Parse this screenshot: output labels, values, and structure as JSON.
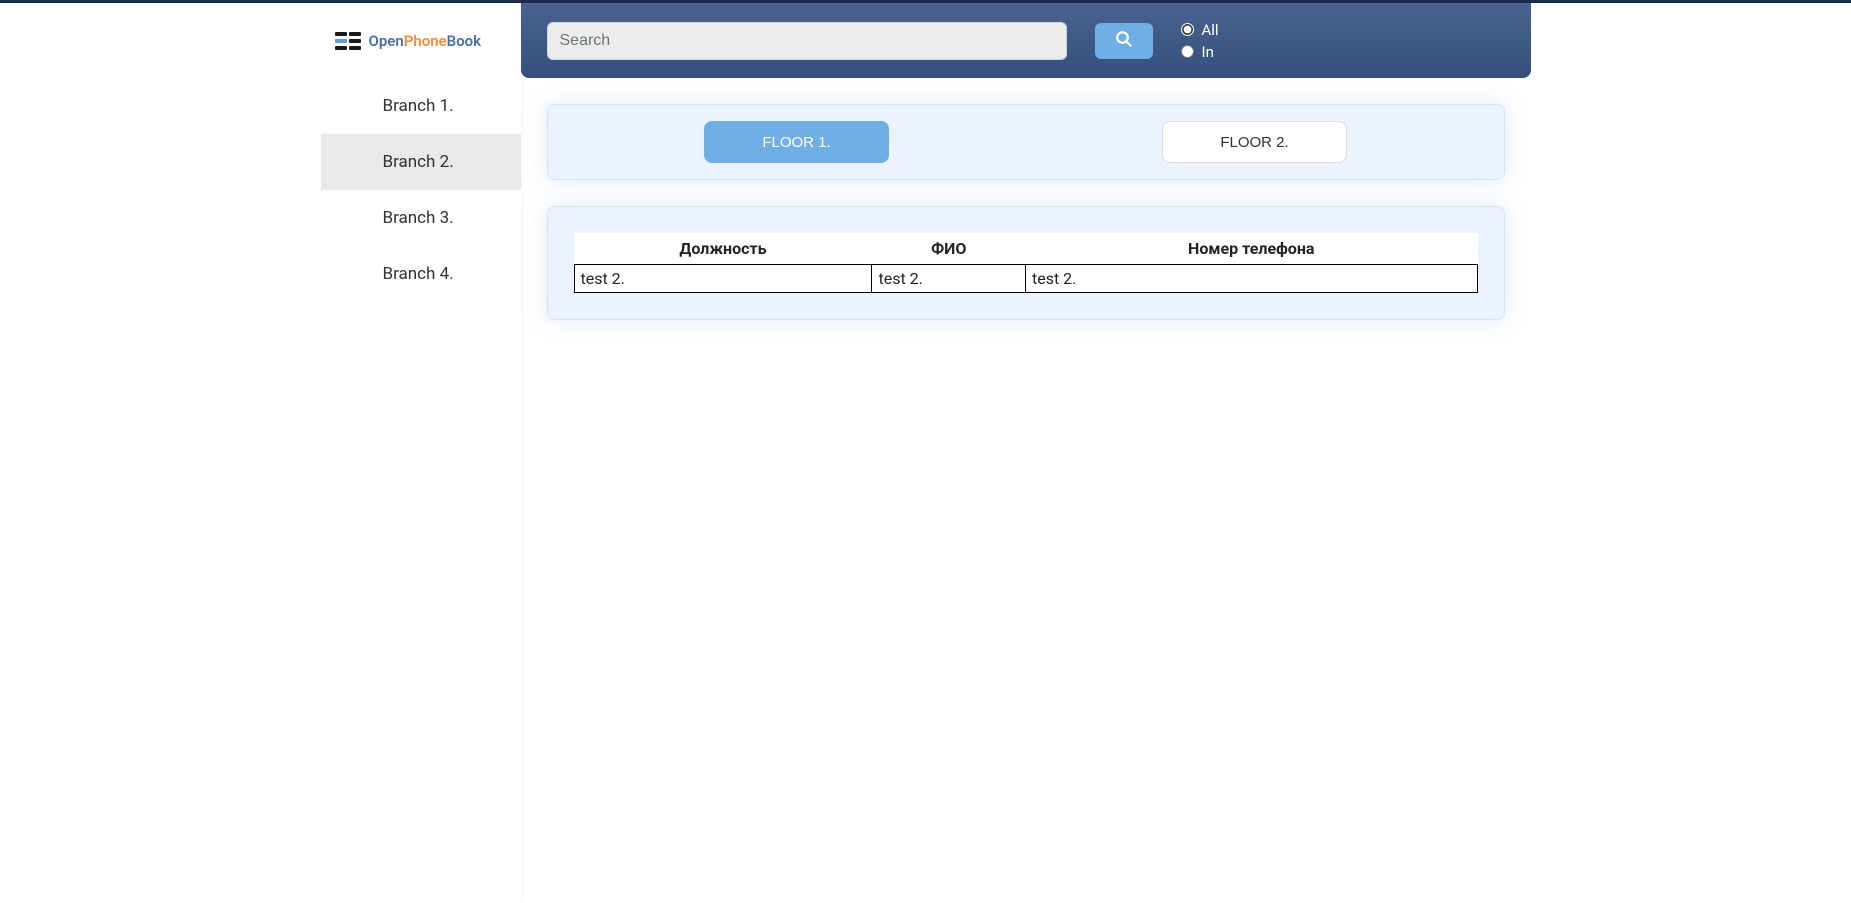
{
  "logo": {
    "open": "Open",
    "phone": "Phone",
    "book": "Book"
  },
  "sidebar": {
    "branches": [
      {
        "label": "Branch 1.",
        "active": false
      },
      {
        "label": "Branch 2.",
        "active": true
      },
      {
        "label": "Branch 3.",
        "active": false
      },
      {
        "label": "Branch 4.",
        "active": false
      }
    ]
  },
  "topbar": {
    "search_placeholder": "Search",
    "radios": {
      "all": "All",
      "in": "In",
      "selected": "all"
    }
  },
  "floors": [
    {
      "label": "FLOOR 1.",
      "active": true
    },
    {
      "label": "FLOOR 2.",
      "active": false
    }
  ],
  "table": {
    "headers": [
      "Должность",
      "ФИО",
      "Номер телефона"
    ],
    "rows": [
      {
        "position": "test 2.",
        "name": "test 2.",
        "phone": "test 2."
      }
    ]
  }
}
